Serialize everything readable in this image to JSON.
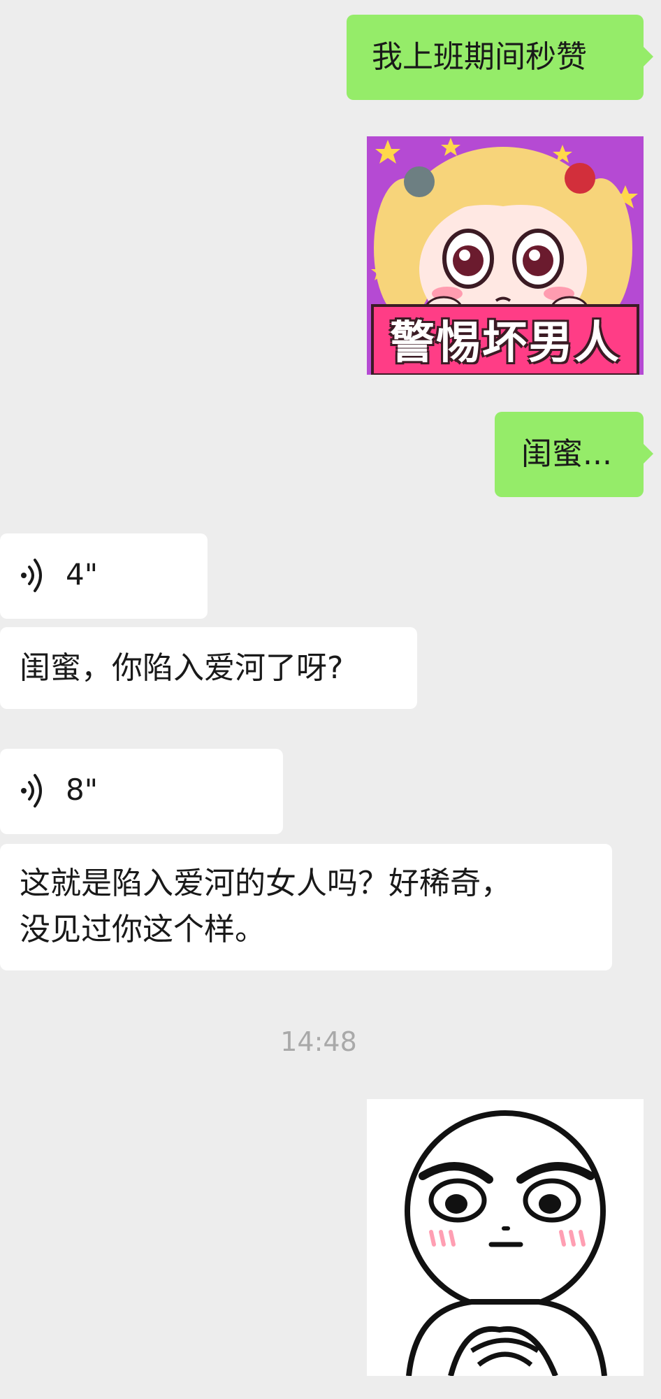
{
  "colors": {
    "background": "#ededed",
    "my_bubble": "#95ec69",
    "their_bubble": "#ffffff",
    "timestamp_text": "#a9a9a9",
    "sticker1_bg": "#b54ad3",
    "sticker1_banner": "#ff3d86"
  },
  "messages": {
    "m1": {
      "text": "我上班期间秒赞"
    },
    "sticker1": {
      "caption": "警惕坏男人",
      "icon": "anime-girl-sticker"
    },
    "m2": {
      "text": "闺蜜..."
    },
    "voice1": {
      "duration": "4\"",
      "icon": "voice-wave-icon"
    },
    "m3": {
      "text": "闺蜜，你陷入爱河了呀?"
    },
    "voice2": {
      "duration": "8\"",
      "icon": "voice-wave-icon"
    },
    "m4": {
      "text": "这就是陷入爱河的女人吗？好稀奇，\n没见过你这个样。"
    },
    "timestamp": "14:48",
    "sticker2": {
      "icon": "suspicious-face-sticker"
    }
  }
}
